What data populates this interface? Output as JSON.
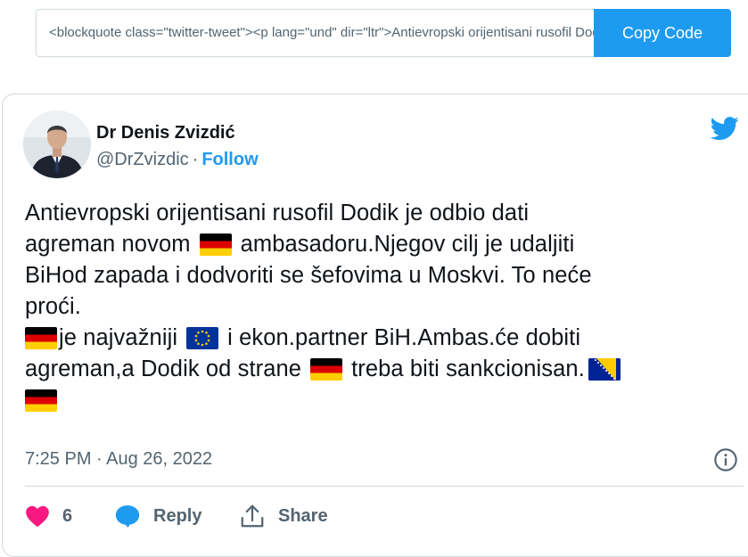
{
  "embed": {
    "code_value": "<blockquote class=\"twitter-tweet\"><p lang=\"und\" dir=\"ltr\">Antievropski orijentisani rusofil Dodik je odbio dati agreman",
    "copy_label": "Copy Code"
  },
  "tweet": {
    "author_name": "Dr Denis Zvizdić",
    "handle": "@DrZvizdic",
    "separator": "·",
    "follow_label": "Follow",
    "text": {
      "l1": "Antievropski orijentisani rusofil Dodik je odbio dati",
      "l2a": "agreman novom",
      "l2b": "ambasadoru.Njegov cilj je udaljiti",
      "l3": "BiHod zapada i dodvoriti se šefovima u Moskvi. To neće",
      "l4": "proći.",
      "l5a": "je najvažniji",
      "l5b": "i ekon.partner BiH.Ambas.će dobiti",
      "l6a": "agreman,a Dodik od strane",
      "l6b": "treba biti sankcionisan."
    },
    "timestamp": "7:25 PM · Aug 26, 2022",
    "like_count": "6",
    "reply_label": "Reply",
    "share_label": "Share"
  },
  "icons": {
    "brand": "twitter-bird-icon",
    "like": "heart-icon",
    "reply": "reply-bubble-icon",
    "share": "share-icon",
    "info": "info-icon",
    "flags": [
      "flag-germany",
      "flag-eu",
      "flag-bosnia"
    ]
  },
  "colors": {
    "accent": "#1d9bf0",
    "like": "#f91880",
    "secondary_text": "#536471",
    "border": "#cfd9de"
  }
}
